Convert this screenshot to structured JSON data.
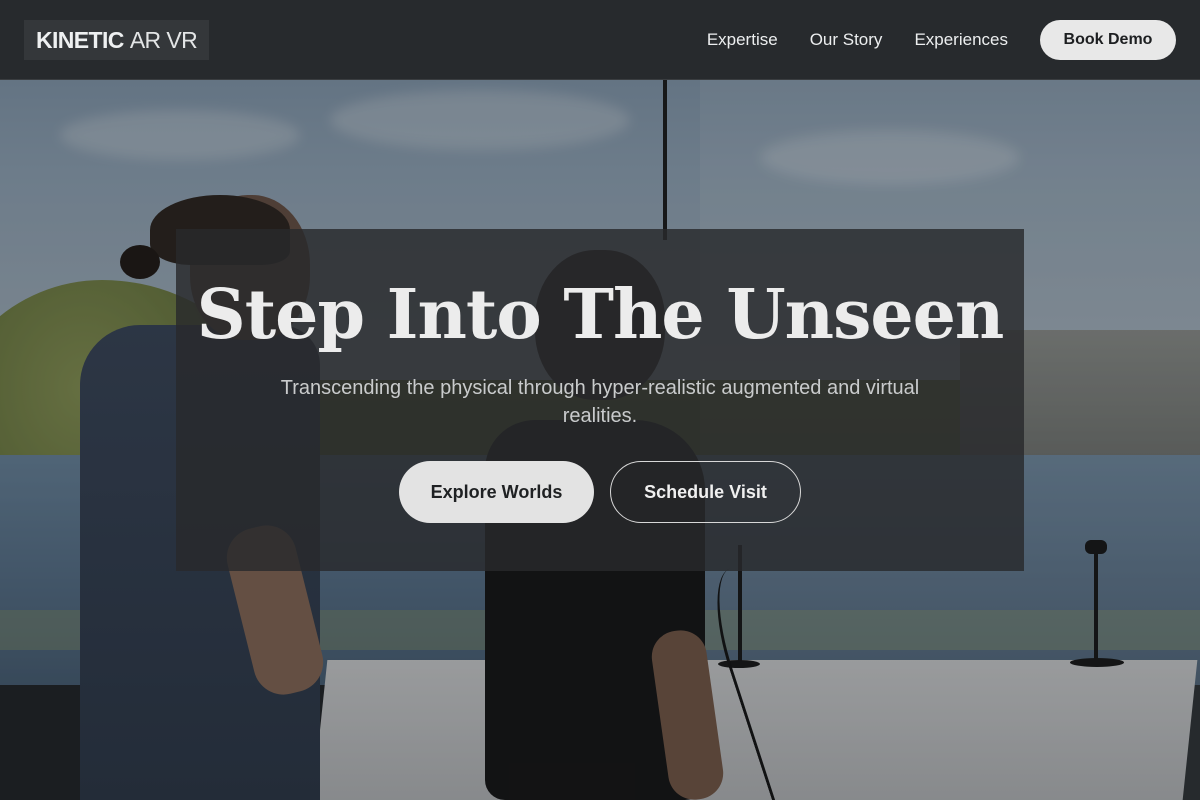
{
  "brand": {
    "logo_strong": "KINETIC",
    "logo_light": "AR VR"
  },
  "nav": {
    "items": [
      {
        "label": "Expertise"
      },
      {
        "label": "Our Story"
      },
      {
        "label": "Experiences"
      }
    ],
    "cta_label": "Book Demo"
  },
  "hero": {
    "title": "Step Into The Unseen",
    "subtitle": "Transcending the physical through hyper-realistic augmented and virtual realities.",
    "primary_button": "Explore Worlds",
    "secondary_button": "Schedule Visit"
  },
  "colors": {
    "nav_background": "#272a2d",
    "hero_panel": "#282a2c",
    "button_light": "#e3e3e3",
    "text_light": "#ececec"
  }
}
